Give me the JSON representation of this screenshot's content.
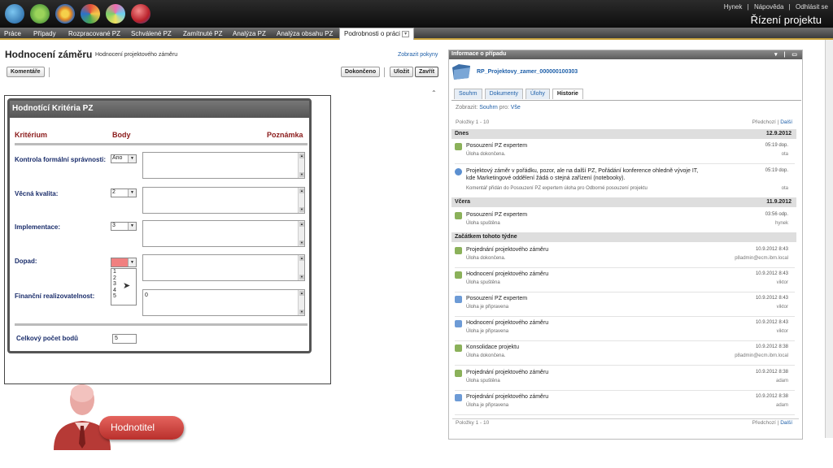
{
  "colors": {
    "accent": "#c8a23c",
    "link": "#1c5ea8",
    "label": "#1a2d6b",
    "header_red": "#8a1a1a",
    "badge": "#d2433f",
    "error_fill": "#f08080"
  },
  "topbar": {
    "links": [
      "Hynek",
      "|",
      "Nápověda",
      "|",
      "Odhlásit se"
    ],
    "title": "Řízení projektu",
    "logos": [
      "globe-logo",
      "leaf-logo",
      "circle-logo",
      "puzzle-logo",
      "star-logo",
      "ball-logo"
    ]
  },
  "nav": {
    "items": [
      "Práce",
      "Případy",
      "Rozpracované PZ",
      "Schválené PZ",
      "Zamítnuté PZ",
      "Analýza PZ",
      "Analýza obsahu PZ",
      "Podrobnosti o práci"
    ],
    "dropdown_icon": "▾"
  },
  "page": {
    "title": "Hodnocení záměru",
    "subtitle": "Hodnocení projektového záměru",
    "show_instructions": "Zobrazit pokyny"
  },
  "toolbar": {
    "comments": "Komentáře",
    "done": "Dokončeno",
    "save": "Uložit",
    "close": "Zavřít"
  },
  "form": {
    "title": "Hodnotící Kritéria PZ",
    "headers": {
      "criterion": "Kritérium",
      "points": "Body",
      "note": "Poznámka"
    },
    "rows": [
      {
        "label": "Kontrola formální správnosti:",
        "value": "Ano",
        "note": ""
      },
      {
        "label": "Věcná kvalita:",
        "value": "2",
        "note": ""
      },
      {
        "label": "Implementace:",
        "value": "3",
        "note": ""
      },
      {
        "label": "Dopad:",
        "value": "",
        "note": ""
      },
      {
        "label": "Finanční realizovatelnost:",
        "value": "",
        "note": "0"
      }
    ],
    "dropdown_options": [
      "1",
      "2",
      "3",
      "4",
      "5"
    ],
    "total_label": "Celkový počet bodů",
    "total_value": "5"
  },
  "role_badge": "Hodnotitel",
  "info": {
    "header": "Informace o případu",
    "window_controls": "▾ | ▭",
    "case_name": "RP_Projektovy_zamer_000000100303",
    "tabs": [
      "Souhrn",
      "Dokumenty",
      "Úlohy",
      "Historie"
    ],
    "show_label": "Zobrazit:",
    "show_value": "Souhrn",
    "for_label": "pro:",
    "for_value": "Vše",
    "items_range": "Položky 1 - 10",
    "prev": "Předchozí",
    "sep": "|",
    "next": "Další",
    "groups": [
      {
        "label": "Dnes",
        "date": "12.9.2012",
        "items": [
          {
            "icon": "task-icon",
            "title": "Posouzení PZ expertem",
            "status": "Úloha dokončena.",
            "time": "05:19 dop.",
            "user": "ota"
          },
          {
            "icon": "comment-icon",
            "title": "Projektový záměr v pořádku, pozor, ale na další PZ, Pořádání konference ohledně vývoje IT, kde Marketingové oddělení žádá o stejná zařízení (notebooky).",
            "status": "Komentář přidán do Posouzení PZ expertem úloha pro Odborné posouzení projektu",
            "time": "05:19 dop.",
            "user": "ota"
          }
        ]
      },
      {
        "label": "Včera",
        "date": "11.9.2012",
        "items": [
          {
            "icon": "task-icon",
            "title": "Posouzení PZ expertem",
            "status": "Úloha spuštěna",
            "time": "03:56 odp.",
            "user": "hynek"
          }
        ]
      },
      {
        "label": "Začátkem tohoto týdne",
        "date": "",
        "items": [
          {
            "icon": "task-icon",
            "title": "Projednání projektového záměru",
            "status": "Úloha dokončena.",
            "time": "10.9.2012 8:43",
            "user": "p8admin@ecm.ibm.local"
          },
          {
            "icon": "task-icon",
            "title": "Hodnocení projektového záměru",
            "status": "Úloha spuštěna",
            "time": "10.9.2012 8:43",
            "user": "viktor"
          },
          {
            "icon": "doc-icon",
            "title": "Posouzení PZ expertem",
            "status": "Úloha je připravena",
            "time": "10.9.2012 8:43",
            "user": "viktor"
          },
          {
            "icon": "doc-icon",
            "title": "Hodnocení projektového záměru",
            "status": "Úloha je připravena",
            "time": "10.9.2012 8:43",
            "user": "viktor"
          },
          {
            "icon": "task-icon",
            "title": "Konsolidace projektu",
            "status": "Úloha dokončena.",
            "time": "10.9.2012 8:38",
            "user": "p8admin@ecm.ibm.local"
          },
          {
            "icon": "task-icon",
            "title": "Projednání projektového záměru",
            "status": "Úloha spuštěna",
            "time": "10.9.2012 8:38",
            "user": "adam"
          },
          {
            "icon": "doc-icon",
            "title": "Projednání projektového záměru",
            "status": "Úloha je připravena",
            "time": "10.9.2012 8:38",
            "user": "adam"
          }
        ]
      }
    ]
  }
}
